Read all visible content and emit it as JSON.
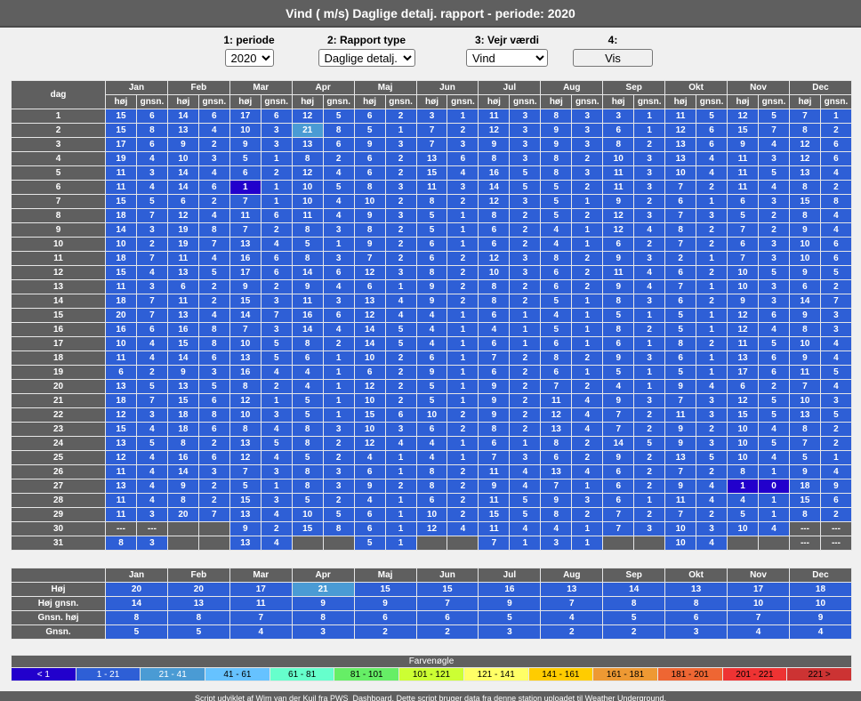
{
  "title": "Vind ( m/s) Daglige detalj. rapport - periode: 2020",
  "controls": {
    "periode_label": "1: periode",
    "periode_value": "2020",
    "rapport_label": "2: Rapport type",
    "rapport_value": "Daglige detalj.",
    "vejr_label": "3: Vejr værdi",
    "vejr_value": "Vind",
    "vis_label": "4:",
    "vis_button": "Vis"
  },
  "header": {
    "dag": "dag",
    "hoj": "høj",
    "gnsn": "gnsn."
  },
  "months": [
    "Jan",
    "Feb",
    "Mar",
    "Apr",
    "Maj",
    "Jun",
    "Jul",
    "Aug",
    "Sep",
    "Okt",
    "Nov",
    "Dec"
  ],
  "days": [
    {
      "d": "1",
      "v": [
        "15",
        "6",
        "14",
        "6",
        "17",
        "6",
        "12",
        "5",
        "6",
        "2",
        "3",
        "1",
        "11",
        "3",
        "8",
        "3",
        "3",
        "1",
        "11",
        "5",
        "12",
        "5",
        "7",
        "1"
      ]
    },
    {
      "d": "2",
      "v": [
        "15",
        "8",
        "13",
        "4",
        "10",
        "3",
        "21",
        "8",
        "5",
        "1",
        "7",
        "2",
        "12",
        "3",
        "9",
        "3",
        "6",
        "1",
        "12",
        "6",
        "15",
        "7",
        "8",
        "2"
      ]
    },
    {
      "d": "3",
      "v": [
        "17",
        "6",
        "9",
        "2",
        "9",
        "3",
        "13",
        "6",
        "9",
        "3",
        "7",
        "3",
        "9",
        "3",
        "9",
        "3",
        "8",
        "2",
        "13",
        "6",
        "9",
        "4",
        "12",
        "6"
      ]
    },
    {
      "d": "4",
      "v": [
        "19",
        "4",
        "10",
        "3",
        "5",
        "1",
        "8",
        "2",
        "6",
        "2",
        "13",
        "6",
        "8",
        "3",
        "8",
        "2",
        "10",
        "3",
        "13",
        "4",
        "11",
        "3",
        "12",
        "6"
      ]
    },
    {
      "d": "5",
      "v": [
        "11",
        "3",
        "14",
        "4",
        "6",
        "2",
        "12",
        "4",
        "6",
        "2",
        "15",
        "4",
        "16",
        "5",
        "8",
        "3",
        "11",
        "3",
        "10",
        "4",
        "11",
        "5",
        "13",
        "4"
      ]
    },
    {
      "d": "6",
      "v": [
        "11",
        "4",
        "14",
        "6",
        "1",
        "1",
        "10",
        "5",
        "8",
        "3",
        "11",
        "3",
        "14",
        "5",
        "5",
        "2",
        "11",
        "3",
        "7",
        "2",
        "11",
        "4",
        "8",
        "2"
      ]
    },
    {
      "d": "7",
      "v": [
        "15",
        "5",
        "6",
        "2",
        "7",
        "1",
        "10",
        "4",
        "10",
        "2",
        "8",
        "2",
        "12",
        "3",
        "5",
        "1",
        "9",
        "2",
        "6",
        "1",
        "6",
        "3",
        "15",
        "8"
      ]
    },
    {
      "d": "8",
      "v": [
        "18",
        "7",
        "12",
        "4",
        "11",
        "6",
        "11",
        "4",
        "9",
        "3",
        "5",
        "1",
        "8",
        "2",
        "5",
        "2",
        "12",
        "3",
        "7",
        "3",
        "5",
        "2",
        "8",
        "4"
      ]
    },
    {
      "d": "9",
      "v": [
        "14",
        "3",
        "19",
        "8",
        "7",
        "2",
        "8",
        "3",
        "8",
        "2",
        "5",
        "1",
        "6",
        "2",
        "4",
        "1",
        "12",
        "4",
        "8",
        "2",
        "7",
        "2",
        "9",
        "4"
      ]
    },
    {
      "d": "10",
      "v": [
        "10",
        "2",
        "19",
        "7",
        "13",
        "4",
        "5",
        "1",
        "9",
        "2",
        "6",
        "1",
        "6",
        "2",
        "4",
        "1",
        "6",
        "2",
        "7",
        "2",
        "6",
        "3",
        "10",
        "6"
      ]
    },
    {
      "d": "11",
      "v": [
        "18",
        "7",
        "11",
        "4",
        "16",
        "6",
        "8",
        "3",
        "7",
        "2",
        "6",
        "2",
        "12",
        "3",
        "8",
        "2",
        "9",
        "3",
        "2",
        "1",
        "7",
        "3",
        "10",
        "6"
      ]
    },
    {
      "d": "12",
      "v": [
        "15",
        "4",
        "13",
        "5",
        "17",
        "6",
        "14",
        "6",
        "12",
        "3",
        "8",
        "2",
        "10",
        "3",
        "6",
        "2",
        "11",
        "4",
        "6",
        "2",
        "10",
        "5",
        "9",
        "5"
      ]
    },
    {
      "d": "13",
      "v": [
        "11",
        "3",
        "6",
        "2",
        "9",
        "2",
        "9",
        "4",
        "6",
        "1",
        "9",
        "2",
        "8",
        "2",
        "6",
        "2",
        "9",
        "4",
        "7",
        "1",
        "10",
        "3",
        "6",
        "2"
      ]
    },
    {
      "d": "14",
      "v": [
        "18",
        "7",
        "11",
        "2",
        "15",
        "3",
        "11",
        "3",
        "13",
        "4",
        "9",
        "2",
        "8",
        "2",
        "5",
        "1",
        "8",
        "3",
        "6",
        "2",
        "9",
        "3",
        "14",
        "7"
      ]
    },
    {
      "d": "15",
      "v": [
        "20",
        "7",
        "13",
        "4",
        "14",
        "7",
        "16",
        "6",
        "12",
        "4",
        "4",
        "1",
        "6",
        "1",
        "4",
        "1",
        "5",
        "1",
        "5",
        "1",
        "12",
        "6",
        "9",
        "3"
      ]
    },
    {
      "d": "16",
      "v": [
        "16",
        "6",
        "16",
        "8",
        "7",
        "3",
        "14",
        "4",
        "14",
        "5",
        "4",
        "1",
        "4",
        "1",
        "5",
        "1",
        "8",
        "2",
        "5",
        "1",
        "12",
        "4",
        "8",
        "3"
      ]
    },
    {
      "d": "17",
      "v": [
        "10",
        "4",
        "15",
        "8",
        "10",
        "5",
        "8",
        "2",
        "14",
        "5",
        "4",
        "1",
        "6",
        "1",
        "6",
        "1",
        "6",
        "1",
        "8",
        "2",
        "11",
        "5",
        "10",
        "4"
      ]
    },
    {
      "d": "18",
      "v": [
        "11",
        "4",
        "14",
        "6",
        "13",
        "5",
        "6",
        "1",
        "10",
        "2",
        "6",
        "1",
        "7",
        "2",
        "8",
        "2",
        "9",
        "3",
        "6",
        "1",
        "13",
        "6",
        "9",
        "4"
      ]
    },
    {
      "d": "19",
      "v": [
        "6",
        "2",
        "9",
        "3",
        "16",
        "4",
        "4",
        "1",
        "6",
        "2",
        "9",
        "1",
        "6",
        "2",
        "6",
        "1",
        "5",
        "1",
        "5",
        "1",
        "17",
        "6",
        "11",
        "5"
      ]
    },
    {
      "d": "20",
      "v": [
        "13",
        "5",
        "13",
        "5",
        "8",
        "2",
        "4",
        "1",
        "12",
        "2",
        "5",
        "1",
        "9",
        "2",
        "7",
        "2",
        "4",
        "1",
        "9",
        "4",
        "6",
        "2",
        "7",
        "4"
      ]
    },
    {
      "d": "21",
      "v": [
        "18",
        "7",
        "15",
        "6",
        "12",
        "1",
        "5",
        "1",
        "10",
        "2",
        "5",
        "1",
        "9",
        "2",
        "11",
        "4",
        "9",
        "3",
        "7",
        "3",
        "12",
        "5",
        "10",
        "3"
      ]
    },
    {
      "d": "22",
      "v": [
        "12",
        "3",
        "18",
        "8",
        "10",
        "3",
        "5",
        "1",
        "15",
        "6",
        "10",
        "2",
        "9",
        "2",
        "12",
        "4",
        "7",
        "2",
        "11",
        "3",
        "15",
        "5",
        "13",
        "5"
      ]
    },
    {
      "d": "23",
      "v": [
        "15",
        "4",
        "18",
        "6",
        "8",
        "4",
        "8",
        "3",
        "10",
        "3",
        "6",
        "2",
        "8",
        "2",
        "13",
        "4",
        "7",
        "2",
        "9",
        "2",
        "10",
        "4",
        "8",
        "2"
      ]
    },
    {
      "d": "24",
      "v": [
        "13",
        "5",
        "8",
        "2",
        "13",
        "5",
        "8",
        "2",
        "12",
        "4",
        "4",
        "1",
        "6",
        "1",
        "8",
        "2",
        "14",
        "5",
        "9",
        "3",
        "10",
        "5",
        "7",
        "2"
      ]
    },
    {
      "d": "25",
      "v": [
        "12",
        "4",
        "16",
        "6",
        "12",
        "4",
        "5",
        "2",
        "4",
        "1",
        "4",
        "1",
        "7",
        "3",
        "6",
        "2",
        "9",
        "2",
        "13",
        "5",
        "10",
        "4",
        "5",
        "1"
      ]
    },
    {
      "d": "26",
      "v": [
        "11",
        "4",
        "14",
        "3",
        "7",
        "3",
        "8",
        "3",
        "6",
        "1",
        "8",
        "2",
        "11",
        "4",
        "13",
        "4",
        "6",
        "2",
        "7",
        "2",
        "8",
        "1",
        "9",
        "4"
      ]
    },
    {
      "d": "27",
      "v": [
        "13",
        "4",
        "9",
        "2",
        "5",
        "1",
        "8",
        "3",
        "9",
        "2",
        "8",
        "2",
        "9",
        "4",
        "7",
        "1",
        "6",
        "2",
        "9",
        "4",
        "1",
        "0",
        "18",
        "9"
      ]
    },
    {
      "d": "28",
      "v": [
        "11",
        "4",
        "8",
        "2",
        "15",
        "3",
        "5",
        "2",
        "4",
        "1",
        "6",
        "2",
        "11",
        "5",
        "9",
        "3",
        "6",
        "1",
        "11",
        "4",
        "4",
        "1",
        "15",
        "6"
      ]
    },
    {
      "d": "29",
      "v": [
        "11",
        "3",
        "20",
        "7",
        "13",
        "4",
        "10",
        "5",
        "6",
        "1",
        "10",
        "2",
        "15",
        "5",
        "8",
        "2",
        "7",
        "2",
        "7",
        "2",
        "5",
        "1",
        "8",
        "2"
      ]
    },
    {
      "d": "30",
      "v": [
        "---",
        "---",
        "",
        "",
        "9",
        "2",
        "15",
        "8",
        "6",
        "1",
        "12",
        "4",
        "11",
        "4",
        "4",
        "1",
        "7",
        "3",
        "10",
        "3",
        "10",
        "4",
        "---",
        "---"
      ]
    },
    {
      "d": "31",
      "v": [
        "8",
        "3",
        "",
        "",
        "13",
        "4",
        "",
        "",
        "5",
        "1",
        "",
        "",
        "7",
        "1",
        "3",
        "1",
        "",
        "",
        "10",
        "4",
        "",
        "",
        "---",
        "---"
      ]
    }
  ],
  "summary": {
    "rows": [
      {
        "label": "Høj",
        "v": [
          "20",
          "20",
          "17",
          "21",
          "15",
          "15",
          "16",
          "13",
          "14",
          "13",
          "17",
          "18"
        ]
      },
      {
        "label": "Høj gnsn.",
        "v": [
          "14",
          "13",
          "11",
          "9",
          "9",
          "7",
          "9",
          "7",
          "8",
          "8",
          "10",
          "10"
        ]
      },
      {
        "label": "Gnsn. høj",
        "v": [
          "8",
          "8",
          "7",
          "8",
          "6",
          "6",
          "5",
          "4",
          "5",
          "6",
          "7",
          "9"
        ]
      },
      {
        "label": "Gnsn.",
        "v": [
          "5",
          "5",
          "4",
          "3",
          "2",
          "2",
          "3",
          "2",
          "2",
          "3",
          "4",
          "4"
        ]
      }
    ]
  },
  "legend": {
    "title": "Farvenøgle",
    "items": [
      {
        "label": "< 1",
        "bg": "#2200cc",
        "fg": "#ffffff"
      },
      {
        "label": "1 - 21",
        "bg": "#2e5fd6",
        "fg": "#ffffff"
      },
      {
        "label": "21 - 41",
        "bg": "#4a9bd4",
        "fg": "#ffffff"
      },
      {
        "label": "41 - 61",
        "bg": "#66c2ff",
        "fg": "#000000"
      },
      {
        "label": "61 - 81",
        "bg": "#66ffcc",
        "fg": "#000000"
      },
      {
        "label": "81 - 101",
        "bg": "#66ee66",
        "fg": "#000000"
      },
      {
        "label": "101 - 121",
        "bg": "#ccff33",
        "fg": "#000000"
      },
      {
        "label": "121 - 141",
        "bg": "#ffff66",
        "fg": "#000000"
      },
      {
        "label": "141 - 161",
        "bg": "#ffcc00",
        "fg": "#000000"
      },
      {
        "label": "161 - 181",
        "bg": "#ee9933",
        "fg": "#000000"
      },
      {
        "label": "181 - 201",
        "bg": "#ee6633",
        "fg": "#000000"
      },
      {
        "label": "201 - 221",
        "bg": "#ee3333",
        "fg": "#000000"
      },
      {
        "label": "221 >",
        "bg": "#cc3333",
        "fg": "#000000"
      }
    ]
  },
  "footer": "Script udviklet af Wim van der Kuil fra PWS_Dashboard.  Dette script bruger data fra denne station uploadet til Weather Underground."
}
